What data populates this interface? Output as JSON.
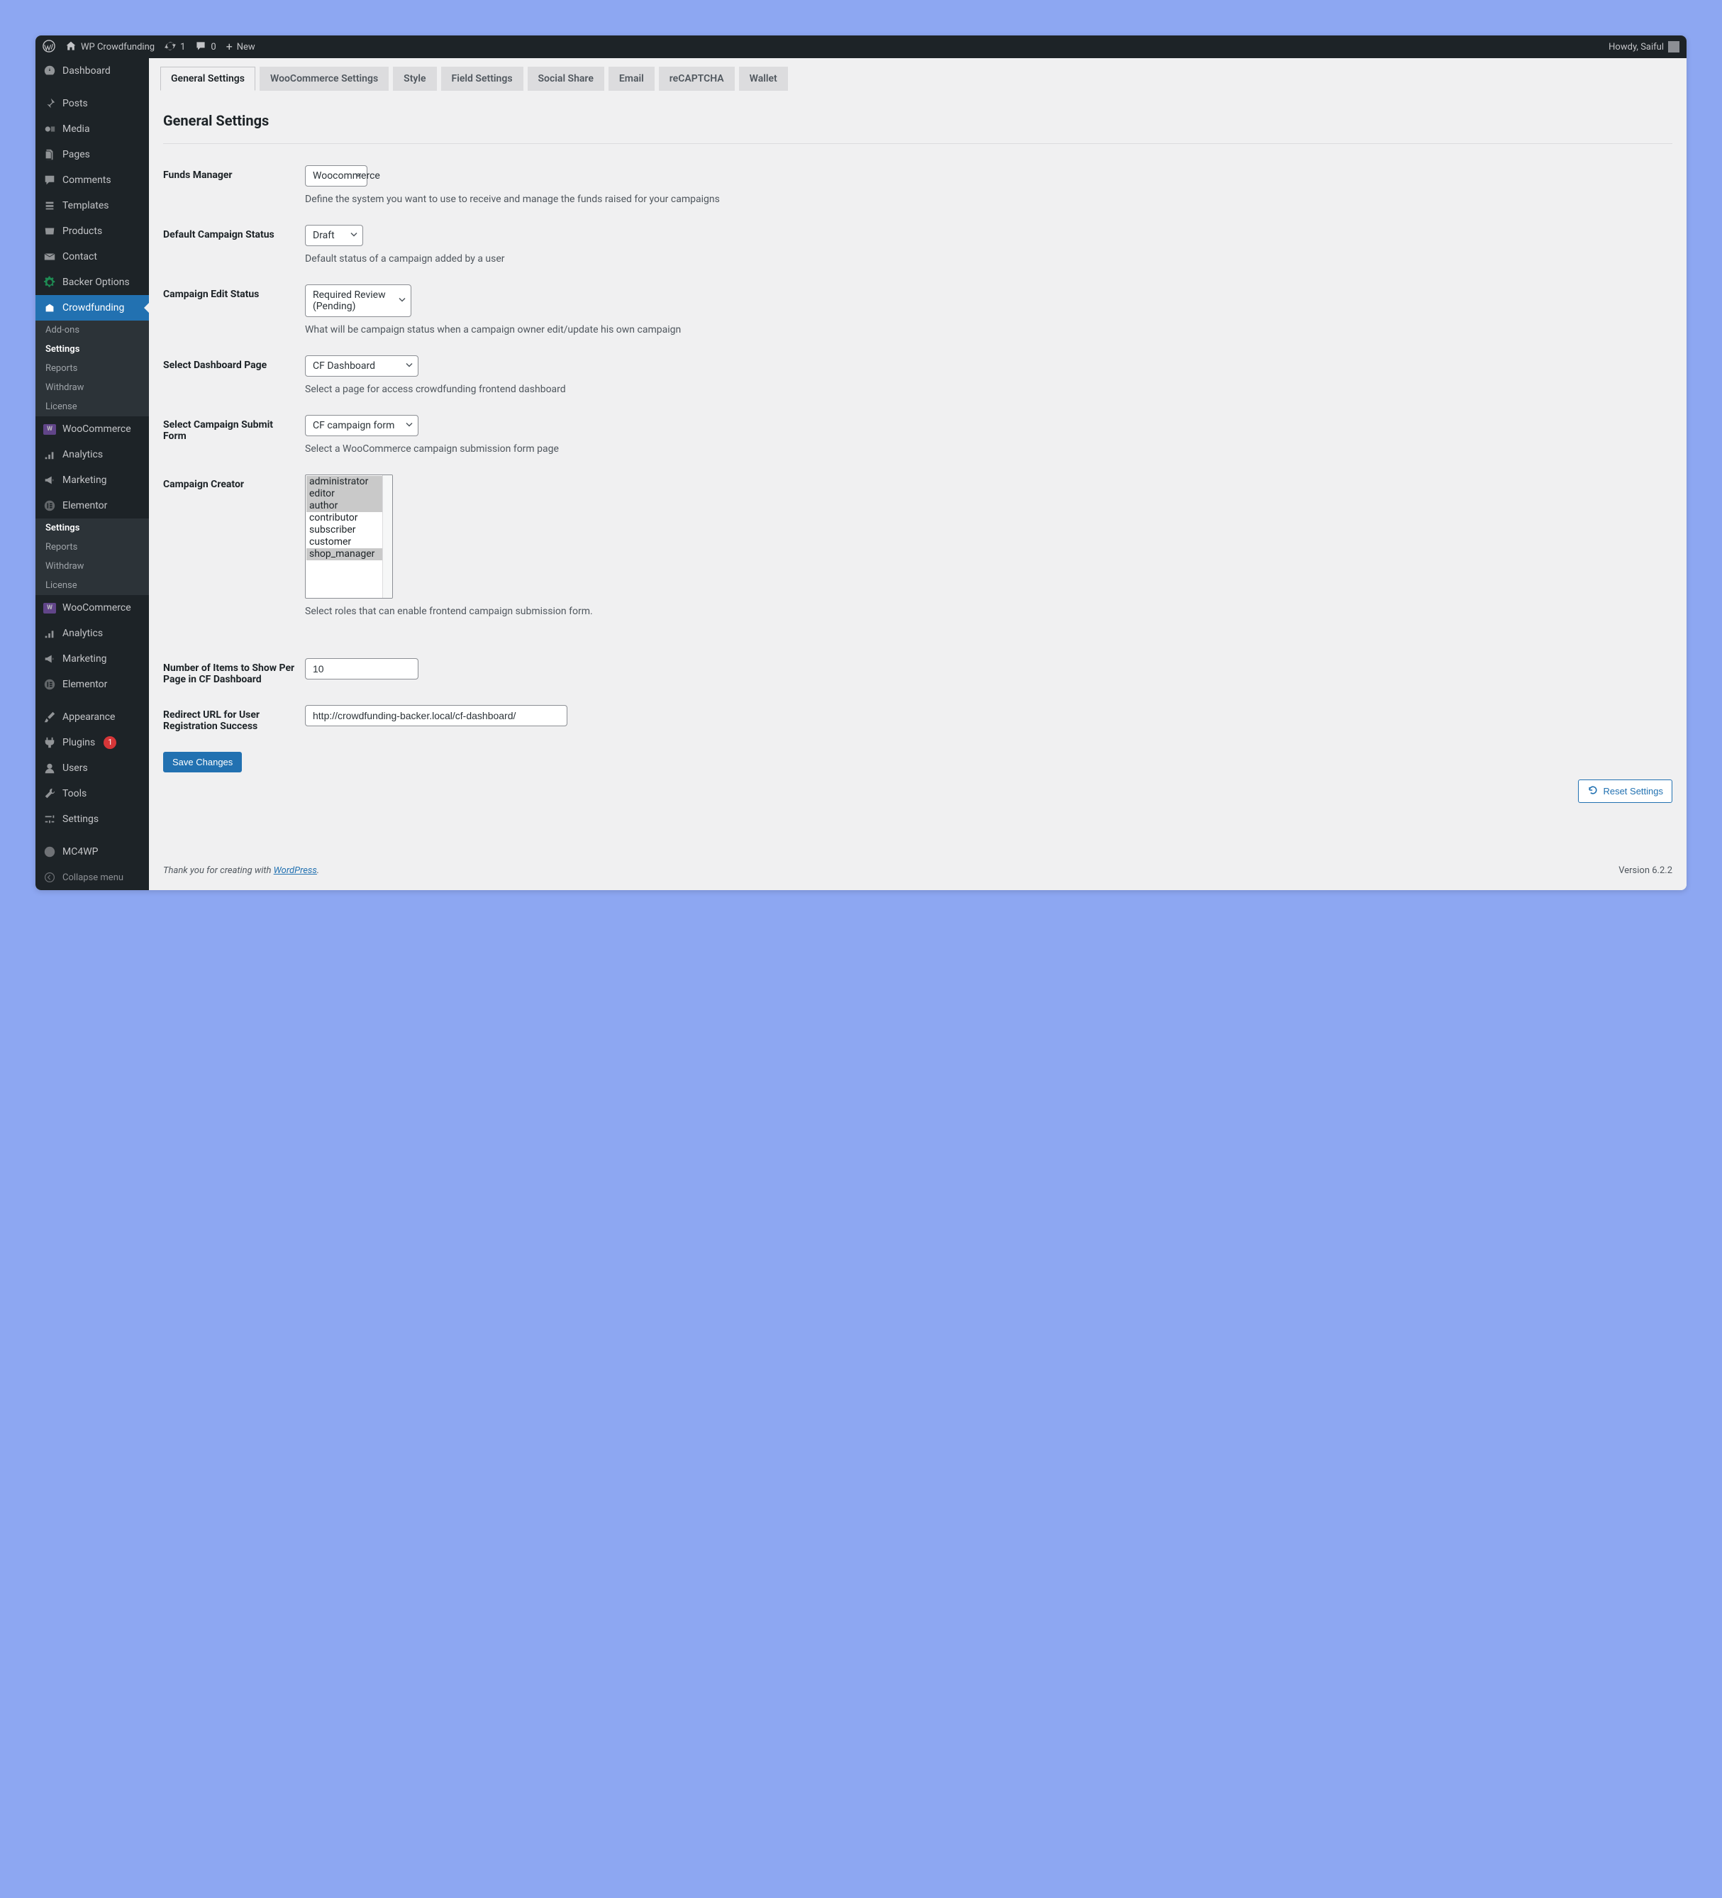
{
  "adminbar": {
    "site_name": "WP Crowdfunding",
    "updates": "1",
    "comments": "0",
    "new": "New",
    "howdy": "Howdy, Saiful"
  },
  "menu": {
    "dashboard": "Dashboard",
    "posts": "Posts",
    "media": "Media",
    "pages": "Pages",
    "comments": "Comments",
    "templates": "Templates",
    "products": "Products",
    "contact": "Contact",
    "backer_options": "Backer Options",
    "crowdfunding": "Crowdfunding",
    "sub_addons": "Add-ons",
    "sub_settings": "Settings",
    "sub_reports": "Reports",
    "sub_withdraw": "Withdraw",
    "sub_license": "License",
    "woocommerce": "WooCommerce",
    "analytics": "Analytics",
    "marketing": "Marketing",
    "elementor": "Elementor",
    "appearance": "Appearance",
    "plugins": "Plugins",
    "plugins_badge": "1",
    "users": "Users",
    "tools": "Tools",
    "settings": "Settings",
    "mc4wp": "MC4WP",
    "collapse": "Collapse menu"
  },
  "tabs": {
    "general": "General Settings",
    "woocommerce": "WooCommerce Settings",
    "style": "Style",
    "field": "Field Settings",
    "social": "Social Share",
    "email": "Email",
    "recaptcha": "reCAPTCHA",
    "wallet": "Wallet"
  },
  "page_title": "General Settings",
  "fields": {
    "funds_manager": {
      "label": "Funds Manager",
      "value": "Woocommerce",
      "desc": "Define the system you want to use to receive and manage the funds raised for your campaigns"
    },
    "default_status": {
      "label": "Default Campaign Status",
      "value": "Draft",
      "desc": "Default status of a campaign added by a user"
    },
    "edit_status": {
      "label": "Campaign Edit Status",
      "value": "Required Review (Pending)",
      "desc": "What will be campaign status when a campaign owner edit/update his own campaign"
    },
    "dashboard_page": {
      "label": "Select Dashboard Page",
      "value": "CF Dashboard",
      "desc": "Select a page for access crowdfunding frontend dashboard"
    },
    "submit_form": {
      "label": "Select Campaign Submit Form",
      "value": "CF campaign form",
      "desc": "Select a WooCommerce campaign submission form page"
    },
    "creator": {
      "label": "Campaign Creator",
      "options": [
        "administrator",
        "editor",
        "author",
        "contributor",
        "subscriber",
        "customer",
        "shop_manager"
      ],
      "selected": [
        "administrator",
        "editor",
        "author",
        "shop_manager"
      ],
      "desc": "Select roles that can enable frontend campaign submission form."
    },
    "items_per_page": {
      "label": "Number of Items to Show Per Page in CF Dashboard",
      "value": "10"
    },
    "redirect_url": {
      "label": "Redirect URL for User Registration Success",
      "value": "http://crowdfunding-backer.local/cf-dashboard/"
    }
  },
  "buttons": {
    "save": "Save Changes",
    "reset": "Reset Settings"
  },
  "footer": {
    "thankyou_prefix": "Thank you for creating with ",
    "wordpress": "WordPress",
    "version": "Version 6.2.2"
  }
}
